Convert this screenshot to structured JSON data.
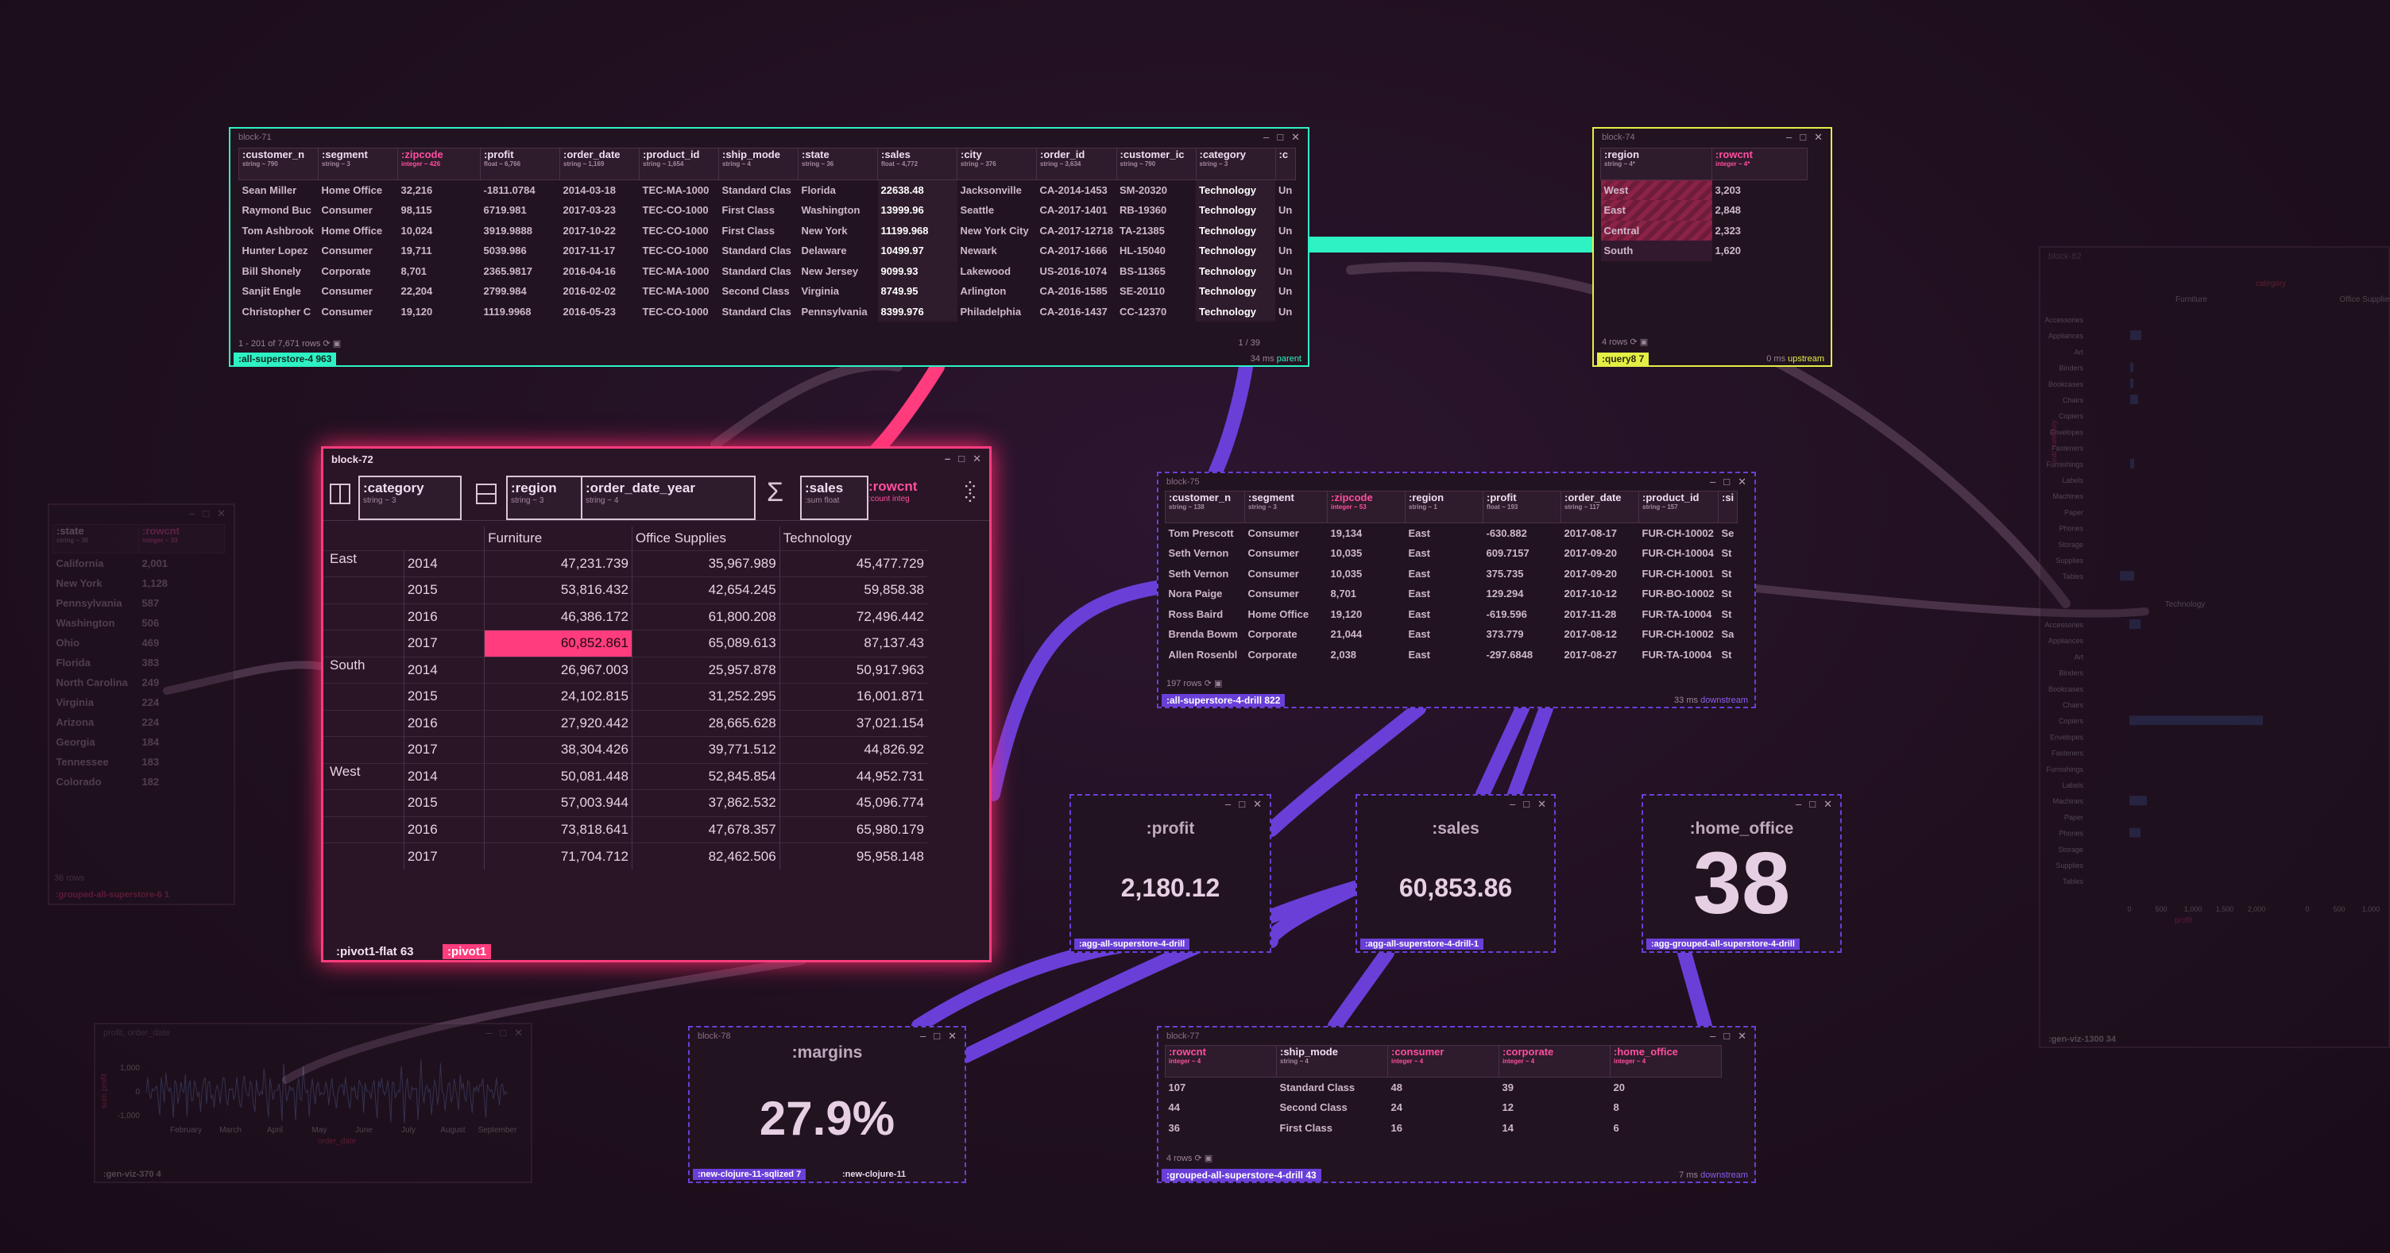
{
  "colors": {
    "accent_teal": "#2ef2c4",
    "accent_pink": "#ff3c7d",
    "accent_purple": "#6a3fd8",
    "accent_yellow": "#e4ef46",
    "field_pink": "#ff4fa0",
    "bg": "#20101f"
  },
  "icons": [
    "minimize-icon",
    "maximize-icon",
    "close-icon",
    "refresh-icon",
    "image-icon",
    "link-icon",
    "columns-icon",
    "rows-icon",
    "sum-icon",
    "grid-dots-icon"
  ],
  "block71": {
    "title": "block-71",
    "columns": [
      {
        "n": ":customer_n",
        "t": "string ~ 790"
      },
      {
        "n": ":segment",
        "t": "string ~ 3"
      },
      {
        "n": ":zipcode",
        "t": "integer ~ 426"
      },
      {
        "n": ":profit",
        "t": "float ~ 6,766"
      },
      {
        "n": ":order_date",
        "t": "string ~ 1,169"
      },
      {
        "n": ":product_id",
        "t": "string ~ 1,654"
      },
      {
        "n": ":ship_mode",
        "t": "string ~ 4"
      },
      {
        "n": ":state",
        "t": "string ~ 36"
      },
      {
        "n": ":sales",
        "t": "float ~ 4,772"
      },
      {
        "n": ":city",
        "t": "string ~ 376"
      },
      {
        "n": ":order_id",
        "t": "string ~ 3,634"
      },
      {
        "n": ":customer_ic",
        "t": "string ~ 790"
      },
      {
        "n": ":category",
        "t": "string ~ 3"
      },
      {
        "n": ":c",
        "t": ""
      }
    ],
    "rows": [
      [
        "Sean Miller",
        "Home Office",
        "32,216",
        "-1811.0784",
        "2014-03-18",
        "TEC-MA-1000",
        "Standard Clas",
        "Florida",
        "22638.48",
        "Jacksonville",
        "CA-2014-1453",
        "SM-20320",
        "Technology",
        "Un"
      ],
      [
        "Raymond Buc",
        "Consumer",
        "98,115",
        "6719.981",
        "2017-03-23",
        "TEC-CO-1000",
        "First Class",
        "Washington",
        "13999.96",
        "Seattle",
        "CA-2017-1401",
        "RB-19360",
        "Technology",
        "Un"
      ],
      [
        "Tom Ashbrook",
        "Home Office",
        "10,024",
        "3919.9888",
        "2017-10-22",
        "TEC-CO-1000",
        "First Class",
        "New York",
        "11199.968",
        "New York City",
        "CA-2017-12718",
        "TA-21385",
        "Technology",
        "Un"
      ],
      [
        "Hunter Lopez",
        "Consumer",
        "19,711",
        "5039.986",
        "2017-11-17",
        "TEC-CO-1000",
        "Standard Clas",
        "Delaware",
        "10499.97",
        "Newark",
        "CA-2017-1666",
        "HL-15040",
        "Technology",
        "Un"
      ],
      [
        "Bill Shonely",
        "Corporate",
        "8,701",
        "2365.9817",
        "2016-04-16",
        "TEC-MA-1000",
        "Standard Clas",
        "New Jersey",
        "9099.93",
        "Lakewood",
        "US-2016-1074",
        "BS-11365",
        "Technology",
        "Un"
      ],
      [
        "Sanjit Engle",
        "Consumer",
        "22,204",
        "2799.984",
        "2016-02-02",
        "TEC-MA-1000",
        "Second Class",
        "Virginia",
        "8749.95",
        "Arlington",
        "CA-2016-1585",
        "SE-20110",
        "Technology",
        "Un"
      ],
      [
        "Christopher C",
        "Consumer",
        "19,120",
        "1119.9968",
        "2016-05-23",
        "TEC-CO-1000",
        "Standard Clas",
        "Pennsylvania",
        "8399.976",
        "Philadelphia",
        "CA-2016-1437",
        "CC-12370",
        "Technology",
        "Un"
      ]
    ],
    "rowcount": "1 - 201 of 7,671 rows",
    "page": "1 / 39",
    "ms": "34 ms",
    "role": "parent",
    "tag": ":all-superstore-4 963"
  },
  "block74": {
    "title": "block-74",
    "columns": [
      {
        "n": ":region",
        "t": "string ~ 4*"
      },
      {
        "n": ":rowcnt",
        "t": "integer ~ 4*"
      }
    ],
    "rows": [
      [
        "West",
        "3,203"
      ],
      [
        "East",
        "2,848"
      ],
      [
        "Central",
        "2,323"
      ],
      [
        "South",
        "1,620"
      ]
    ],
    "rowcount": "4 rows",
    "ms": "0 ms",
    "role": "upstream",
    "tag": ":query8 7"
  },
  "block72": {
    "title": "block-72",
    "col_field": {
      "n": ":category",
      "t": "string ~ 3"
    },
    "row_fields": [
      {
        "n": ":region",
        "t": "string ~ 3"
      },
      {
        "n": ":order_date_year",
        "t": "string ~ 4"
      }
    ],
    "val_fields": [
      {
        "n": ":sales",
        "t": ":sum float"
      },
      {
        "n": ":rowcnt",
        "t": ":count integ"
      }
    ],
    "col_headers": [
      "Furniture",
      "Office Supplies",
      "Technology"
    ],
    "groups": [
      {
        "region": "East",
        "rows": [
          [
            "2014",
            "47,231.739",
            "35,967.989",
            "45,477.729"
          ],
          [
            "2015",
            "53,816.432",
            "42,654.245",
            "59,858.38"
          ],
          [
            "2016",
            "46,386.172",
            "61,800.208",
            "72,496.442"
          ],
          [
            "2017",
            "60,852.861",
            "65,089.613",
            "87,137.43"
          ]
        ]
      },
      {
        "region": "South",
        "rows": [
          [
            "2014",
            "26,967.003",
            "25,957.878",
            "50,917.963"
          ],
          [
            "2015",
            "24,102.815",
            "31,252.295",
            "16,001.871"
          ],
          [
            "2016",
            "27,920.442",
            "28,665.628",
            "37,021.154"
          ],
          [
            "2017",
            "38,304.426",
            "39,771.512",
            "44,826.92"
          ]
        ]
      },
      {
        "region": "West",
        "rows": [
          [
            "2014",
            "50,081.448",
            "52,845.854",
            "44,952.731"
          ],
          [
            "2015",
            "57,003.944",
            "37,862.532",
            "45,096.774"
          ],
          [
            "2016",
            "73,818.641",
            "47,678.357",
            "65,980.179"
          ],
          [
            "2017",
            "71,704.712",
            "82,462.506",
            "95,958.148"
          ]
        ]
      }
    ],
    "tag_left": ":pivot1-flat 63",
    "tag_right": ":pivot1"
  },
  "block75": {
    "title": "block-75",
    "columns": [
      {
        "n": ":customer_n",
        "t": "string ~ 138"
      },
      {
        "n": ":segment",
        "t": "string ~ 3"
      },
      {
        "n": ":zipcode",
        "t": "integer ~ 53"
      },
      {
        "n": ":region",
        "t": "string ~ 1"
      },
      {
        "n": ":profit",
        "t": "float ~ 193"
      },
      {
        "n": ":order_date",
        "t": "string ~ 117"
      },
      {
        "n": ":product_id",
        "t": "string ~ 157"
      },
      {
        "n": ":si",
        "t": ""
      }
    ],
    "rows": [
      [
        "Tom Prescott",
        "Consumer",
        "19,134",
        "East",
        "-630.882",
        "2017-08-17",
        "FUR-CH-10002",
        "Se"
      ],
      [
        "Seth Vernon",
        "Consumer",
        "10,035",
        "East",
        "609.7157",
        "2017-09-20",
        "FUR-CH-10004",
        "St"
      ],
      [
        "Seth Vernon",
        "Consumer",
        "10,035",
        "East",
        "375.735",
        "2017-09-20",
        "FUR-CH-10001",
        "St"
      ],
      [
        "Nora Paige",
        "Consumer",
        "8,701",
        "East",
        "129.294",
        "2017-10-12",
        "FUR-BO-10002",
        "St"
      ],
      [
        "Ross Baird",
        "Home Office",
        "19,120",
        "East",
        "-619.596",
        "2017-11-28",
        "FUR-TA-10004",
        "St"
      ],
      [
        "Brenda Bowm",
        "Corporate",
        "21,044",
        "East",
        "373.779",
        "2017-08-12",
        "FUR-CH-10002",
        "Sa"
      ],
      [
        "Allen Rosenbl",
        "Corporate",
        "2,038",
        "East",
        "-297.6848",
        "2017-08-27",
        "FUR-TA-10004",
        "St"
      ]
    ],
    "rowcount": "197 rows",
    "ms": "33 ms",
    "role": "downstream",
    "tag": ":all-superstore-4-drill 822"
  },
  "kpi_profit": {
    "label": ":profit",
    "value": "2,180.12",
    "tag": ":agg-all-superstore-4-drill",
    "role": "downstream"
  },
  "kpi_sales": {
    "label": ":sales",
    "value": "60,853.86",
    "tag": ":agg-all-superstore-4-drill-1",
    "role": "downstream"
  },
  "kpi_home": {
    "label": ":home_office",
    "value": "38",
    "tag": ":agg-grouped-all-superstore-4-drill"
  },
  "kpi_margins": {
    "title": "block-78",
    "label": ":margins",
    "value": "27.9%",
    "tag": ":new-clojure-11-sqlized 7",
    "tag2": ":new-clojure-11",
    "role": "downstream"
  },
  "block77": {
    "title": "block-77",
    "columns": [
      {
        "n": ":rowcnt",
        "t": "integer ~ 4"
      },
      {
        "n": ":ship_mode",
        "t": "string ~ 4"
      },
      {
        "n": ":consumer",
        "t": "integer ~ 4"
      },
      {
        "n": ":corporate",
        "t": "integer ~ 4"
      },
      {
        "n": ":home_office",
        "t": "integer ~ 4"
      }
    ],
    "rows": [
      [
        "107",
        "Standard Class",
        "48",
        "39",
        "20"
      ],
      [
        "44",
        "Second Class",
        "24",
        "12",
        "8"
      ],
      [
        "36",
        "First Class",
        "16",
        "14",
        "6"
      ]
    ],
    "rowcount": "4 rows",
    "ms": "7 ms",
    "role": "downstream",
    "tag": ":grouped-all-superstore-4-drill 43"
  },
  "left_state": {
    "columns": [
      {
        "n": ":state",
        "t": "string ~ 36"
      },
      {
        "n": ":rowcnt",
        "t": "integer ~ 33"
      }
    ],
    "rows": [
      [
        "California",
        "2,001"
      ],
      [
        "New York",
        "1,128"
      ],
      [
        "Pennsylvania",
        "587"
      ],
      [
        "Washington",
        "506"
      ],
      [
        "Ohio",
        "469"
      ],
      [
        "Florida",
        "383"
      ],
      [
        "North Carolina",
        "249"
      ],
      [
        "Virginia",
        "224"
      ],
      [
        "Arizona",
        "224"
      ],
      [
        "Georgia",
        "184"
      ],
      [
        "Tennessee",
        "183"
      ],
      [
        "Colorado",
        "182"
      ]
    ],
    "rowcount": "36 rows",
    "tag": ":grouped-all-superstore-6 1"
  },
  "timeline": {
    "title": "profit, order_date",
    "ylabel": "sum profit",
    "xlabel": "order_date",
    "ticks_y": [
      "1,000",
      "0",
      "-1,000"
    ],
    "ticks_x": [
      "February",
      "March",
      "April",
      "May",
      "June",
      "July",
      "August",
      "September"
    ],
    "tag": ":gen-viz-370 4"
  },
  "side_chart": {
    "title": "block-82",
    "legend": "category",
    "cols": [
      "Furniture",
      "Office Supplies"
    ],
    "ylabel": "sub_category",
    "subcats": [
      "Accessories",
      "Appliances",
      "Art",
      "Binders",
      "Bookcases",
      "Chairs",
      "Copiers",
      "Envelopes",
      "Fasteners",
      "Furnishings",
      "Labels",
      "Machines",
      "Paper",
      "Phones",
      "Storage",
      "Supplies",
      "Tables"
    ],
    "section2": "Technology",
    "x_ticks": [
      "0",
      "500",
      "1,000",
      "1,500",
      "2,000"
    ],
    "x_ticks2": [
      "0",
      "500",
      "1,000"
    ],
    "xlabel": "profit",
    "tag": ":gen-viz-1300 34"
  }
}
